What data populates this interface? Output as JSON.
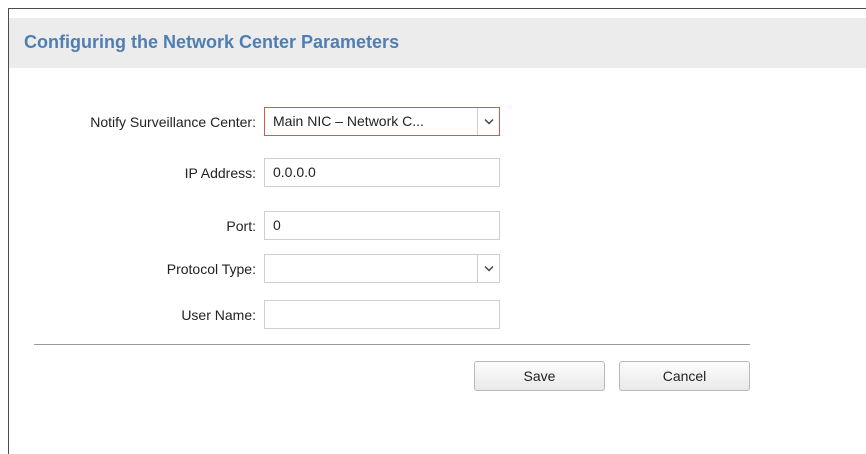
{
  "header": {
    "title": "Configuring the Network Center Parameters"
  },
  "form": {
    "notify_center": {
      "label": "Notify Surveillance Center:",
      "value": "Main NIC – Network C..."
    },
    "ip_address": {
      "label": "IP Address:",
      "value": "0.0.0.0"
    },
    "port": {
      "label": "Port:",
      "value": "0"
    },
    "protocol_type": {
      "label": "Protocol Type:",
      "value": ""
    },
    "user_name": {
      "label": "User Name:",
      "value": ""
    }
  },
  "actions": {
    "save_label": "Save",
    "cancel_label": "Cancel"
  },
  "colors": {
    "title": "#4f7eb3",
    "header_bg": "#ececec",
    "active_border": "#d9534f"
  },
  "icons": {
    "dropdown": "chevron-down-icon"
  }
}
